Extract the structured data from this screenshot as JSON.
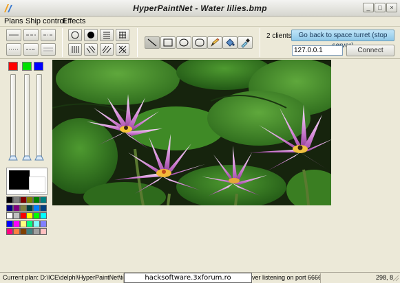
{
  "window": {
    "title": "HyperPaintNet - Water lilies.bmp",
    "controls": {
      "minimize": "_",
      "maximize": "□",
      "close": "×"
    }
  },
  "menu": [
    {
      "label": "Plans",
      "key": "P"
    },
    {
      "label": "Ship control",
      "key": "S"
    },
    {
      "label": "Effects",
      "key": "E"
    }
  ],
  "toolbar": {
    "line_style_icons": [
      "line-style-solid-thin",
      "line-style-dashed",
      "line-style-dash-dot",
      "line-style-dotted",
      "line-style-dash-dot-dot",
      "line-style-double"
    ],
    "fill_style_icons": [
      "fill-clear",
      "fill-solid",
      "fill-horizontal",
      "fill-cross",
      "fill-vertical",
      "fill-bdiagonal",
      "fill-fdiagonal",
      "fill-diagcross"
    ],
    "tool_icons": [
      "line-tool-icon",
      "rectangle-tool-icon",
      "ellipse-tool-icon",
      "rounded-rect-tool-icon",
      "pencil-tool-icon",
      "fill-bucket-tool-icon",
      "eyedropper-tool-icon"
    ],
    "clients_label": "2 clients",
    "go_back_label": "Go back to space turret (stop server)",
    "ip_value": "127.0.0.1",
    "connect_label": "Connect"
  },
  "left_panel": {
    "rgb_colors": [
      "#ff0000",
      "#00e000",
      "#0000ff"
    ],
    "slider_levels": [
      1.0,
      1.0,
      1.0
    ],
    "primary_color": "#000000",
    "secondary_color": "#ffffff",
    "palette": [
      "#000000",
      "#808080",
      "#800000",
      "#808000",
      "#008000",
      "#008080",
      "#000080",
      "#800080",
      "#808040",
      "#004040",
      "#0080ff",
      "#004080",
      "#ffffff",
      "#c0c0c0",
      "#ff0000",
      "#ffff00",
      "#00ff00",
      "#00ffff",
      "#0000ff",
      "#ff00ff",
      "#ffff80",
      "#00ff80",
      "#80ffff",
      "#8080ff",
      "#ff0080",
      "#ff8040",
      "#804000",
      "#408080",
      "#a0a0a0",
      "#ffc0c0"
    ]
  },
  "status": {
    "current_plan": "Current plan: D:\\ICE\\delphi\\HyperPaintNet\\te",
    "server": "ver listening on port 6666",
    "coords": "298, 8",
    "watermark": "hacksoftware.3xforum.ro"
  }
}
